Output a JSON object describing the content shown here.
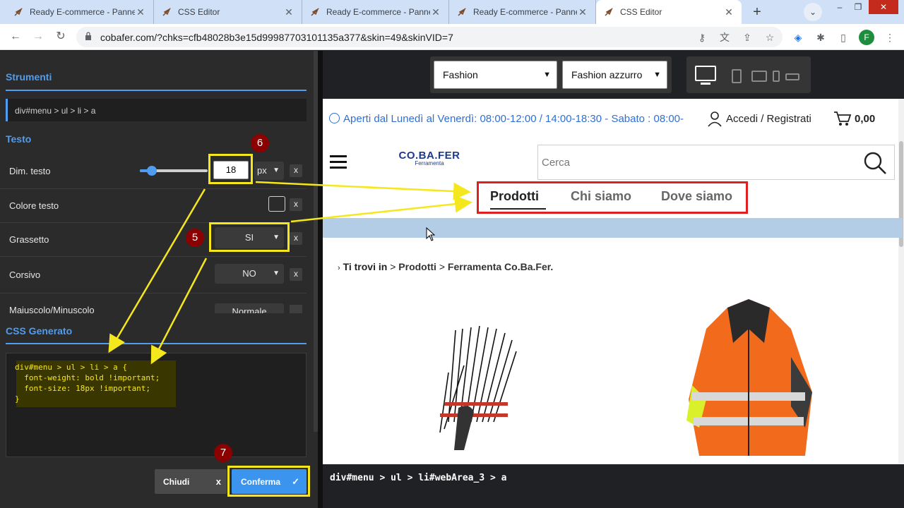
{
  "browser": {
    "tabs": [
      {
        "title": "Ready E-commerce - Pannello",
        "active": false
      },
      {
        "title": "CSS Editor",
        "active": false
      },
      {
        "title": "Ready E-commerce - Pannello",
        "active": false
      },
      {
        "title": "Ready E-commerce - Pannello",
        "active": false
      },
      {
        "title": "CSS Editor",
        "active": true
      }
    ],
    "new_tab_label": "+",
    "url": "cobafer.com/?chks=cfb48028b3e15d99987703101135a377&skin=49&skinVID=7",
    "profile_initial": "F"
  },
  "editor": {
    "strumenti_title": "Strumenti",
    "selector_path": "div#menu > ul > li > a",
    "testo_title": "Testo",
    "rows": {
      "dim_testo": {
        "label": "Dim. testo",
        "value": "18",
        "unit": "px",
        "slider_level": 0.18
      },
      "colore_testo": {
        "label": "Colore testo"
      },
      "grassetto": {
        "label": "Grassetto",
        "value": "SI"
      },
      "corsivo": {
        "label": "Corsivo",
        "value": "NO"
      },
      "maiuscolo": {
        "label": "Maiuscolo/Minuscolo",
        "value": "Normale"
      }
    },
    "clear_label": "x",
    "css_title": "CSS Generato",
    "css_lines": [
      "div#menu > ul > li > a {",
      "  font-weight: bold !important;",
      "  font-size: 18px !important;",
      "}"
    ],
    "btn_chiudi": "Chiudi",
    "btn_chiudi_x": "x",
    "btn_conferma": "Conferma",
    "btn_conferma_check": "✓",
    "badges": {
      "b5": "5",
      "b6": "6",
      "b7": "7"
    }
  },
  "preview_toolbar": {
    "theme_select": "Fashion",
    "color_select": "Fashion azzurro"
  },
  "site": {
    "info_text": "Aperti dal Lunedì al Venerdì: 08:00-12:00 / 14:00-18:30 - Sabato : 08:00-",
    "login_text": "Accedi / Registrati",
    "cart_amount": "0,00",
    "logo_main": "CO.BA.FER",
    "logo_sub": "Ferramenta",
    "search_placeholder": "Cerca",
    "menu": [
      "Prodotti",
      "Chi siamo",
      "Dove siamo"
    ],
    "breadcrumb": {
      "lead": "Ti trovi in",
      "sep": ">",
      "c1": "Prodotti",
      "c2": "Ferramenta Co.Ba.Fer."
    }
  },
  "status_path": "div#menu > ul > li#webArea_3 > a",
  "colors": {
    "accent": "#4f9cf0",
    "highlight": "#f5e71d",
    "menu_box": "#e01f1f",
    "badge": "#8b0000"
  }
}
